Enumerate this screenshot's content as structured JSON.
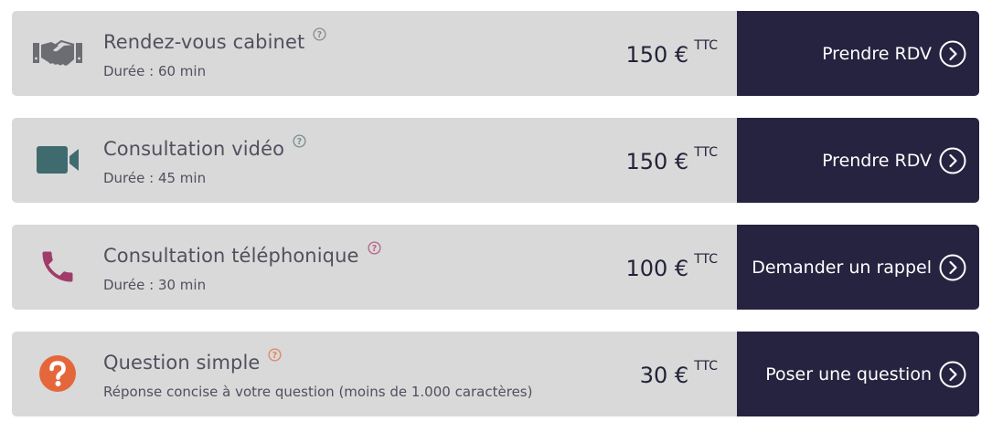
{
  "services": [
    {
      "title": "Rendez-vous cabinet",
      "subtitle": "Durée : 60 min",
      "price": "150 €",
      "price_suffix": "TTC",
      "button_label": "Prendre RDV",
      "icon": "handshake-icon",
      "icon_color": "#6b6d72",
      "help_color": "#8c8c8c"
    },
    {
      "title": "Consultation vidéo",
      "subtitle": "Durée : 45 min",
      "price": "150 €",
      "price_suffix": "TTC",
      "button_label": "Prendre RDV",
      "icon": "video-camera-icon",
      "icon_color": "#3f6b6e",
      "help_color": "#7a8e8f"
    },
    {
      "title": "Consultation téléphonique",
      "subtitle": "Durée : 30 min",
      "price": "100 €",
      "price_suffix": "TTC",
      "button_label": "Demander un rappel",
      "icon": "phone-icon",
      "icon_color": "#a03c6a",
      "help_color": "#b46487"
    },
    {
      "title": "Question simple",
      "subtitle": "Réponse concise à votre question (moins de 1.000 caractères)",
      "price": "30 €",
      "price_suffix": "TTC",
      "button_label": "Poser une question",
      "icon": "question-circle-icon",
      "icon_color": "#e4673c",
      "help_color": "#e2835f"
    }
  ],
  "colors": {
    "row_background": "#d9d9d9",
    "button_background": "#262340",
    "button_text": "#ffffff",
    "title_text": "#50505f",
    "price_text": "#22223a"
  }
}
